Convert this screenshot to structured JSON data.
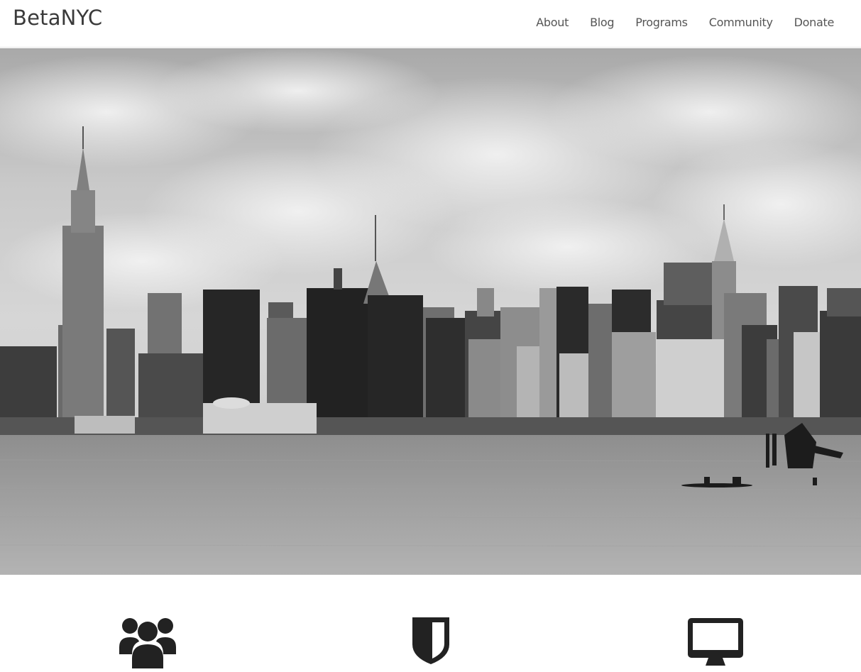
{
  "header": {
    "brand": "BetaNYC",
    "nav": [
      {
        "label": "About"
      },
      {
        "label": "Blog"
      },
      {
        "label": "Programs"
      },
      {
        "label": "Community"
      },
      {
        "label": "Donate"
      }
    ]
  },
  "hero": {
    "image": "nyc-skyline-black-and-white-photo"
  },
  "features": {
    "icons": [
      "users-icon",
      "shield-icon",
      "desktop-icon"
    ]
  },
  "colors": {
    "text": "#3a3a3a",
    "nav_text": "#555555",
    "icon": "#222222",
    "background": "#ffffff"
  }
}
